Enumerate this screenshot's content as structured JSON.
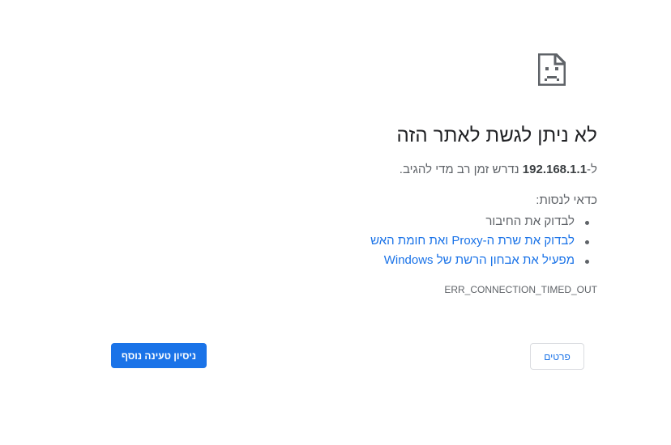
{
  "icon": "sad-page-icon",
  "title": "לא ניתן לגשת לאתר הזה",
  "description": {
    "prefix": "ל-",
    "host": "192.168.1.1",
    "suffix": " נדרש זמן רב מדי להגיב."
  },
  "suggestions": {
    "label": "כדאי לנסות:",
    "items": [
      "לבדוק את החיבור",
      "לבדוק את שרת ה-Proxy ואת חומת האש",
      "מפעיל את אבחון הרשת של Windows"
    ]
  },
  "error_code": "ERR_CONNECTION_TIMED_OUT",
  "buttons": {
    "reload": "ניסיון טעינה נוסף",
    "details": "פרטים"
  },
  "colors": {
    "accent": "#1a73e8",
    "text": "#202124",
    "secondary_text": "#5f6368"
  }
}
